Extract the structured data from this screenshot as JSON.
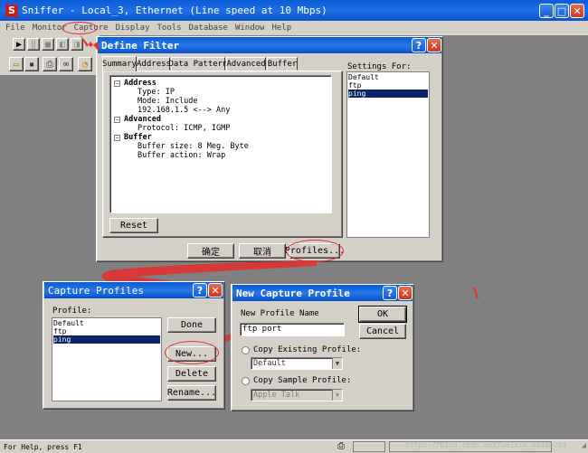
{
  "main_window": {
    "title": "Sniffer - Local_3, Ethernet (Line speed at 10 Mbps)",
    "menu": [
      "File",
      "Monitor",
      "Capture",
      "Display",
      "Tools",
      "Database",
      "Window",
      "Help"
    ],
    "status_text": "For Help, press F1",
    "watermark": "https://blog.csdn.net/weixin_44496284"
  },
  "define_filter": {
    "title": "Define Filter",
    "tabs": [
      "Summary",
      "Address",
      "Data Pattern",
      "Advanced",
      "Buffer"
    ],
    "active_tab": "Summary",
    "tree": {
      "address": "Address",
      "address_items": [
        "Type: IP",
        "Mode: Include",
        "192.168.1.5 <--> Any"
      ],
      "advanced": "Advanced",
      "advanced_items": [
        "Protocol: ICMP, IGMP"
      ],
      "buffer": "Buffer",
      "buffer_items": [
        "Buffer size: 8 Meg. Byte",
        "Buffer action: Wrap"
      ]
    },
    "reset_label": "Reset",
    "settings_for_label": "Settings For:",
    "settings_items": [
      "Default",
      "ftp",
      "ping"
    ],
    "settings_selected": "ping",
    "ok_label": "确定",
    "cancel_label": "取消",
    "profiles_label": "Profiles..."
  },
  "capture_profiles": {
    "title": "Capture Profiles",
    "profile_label": "Profile:",
    "items": [
      "Default",
      "ftp",
      "ping"
    ],
    "selected": "ping",
    "done_label": "Done",
    "new_label": "New...",
    "delete_label": "Delete",
    "rename_label": "Rename..."
  },
  "new_capture_profile": {
    "title": "New Capture Profile",
    "name_label": "New Profile Name",
    "name_value": "ftp port",
    "ok_label": "OK",
    "cancel_label": "Cancel",
    "copy_existing_label": "Copy Existing Profile:",
    "copy_existing_value": "Default",
    "copy_sample_label": "Copy Sample Profile:",
    "copy_sample_value": "Apple Talk"
  },
  "colors": {
    "annotation": "#e03030",
    "title_blue": "#0a5bd6",
    "selection": "#0a246a"
  }
}
